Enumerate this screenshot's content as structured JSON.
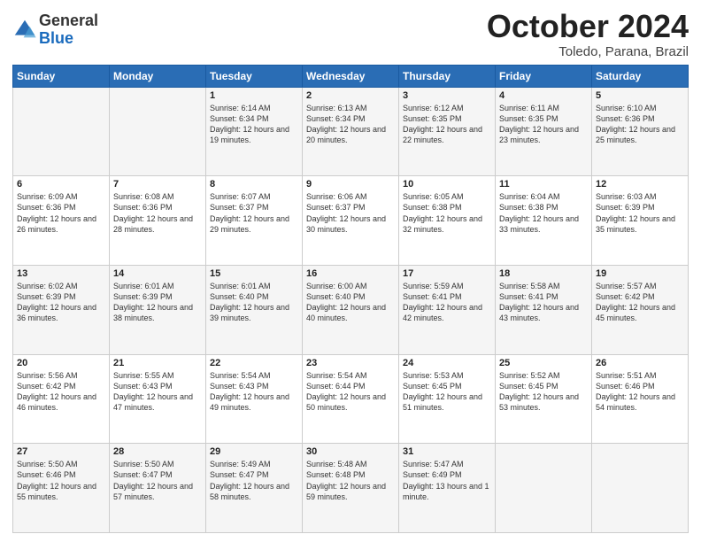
{
  "logo": {
    "general": "General",
    "blue": "Blue"
  },
  "header": {
    "month": "October 2024",
    "location": "Toledo, Parana, Brazil"
  },
  "weekdays": [
    "Sunday",
    "Monday",
    "Tuesday",
    "Wednesday",
    "Thursday",
    "Friday",
    "Saturday"
  ],
  "weeks": [
    [
      {
        "day": "",
        "sunrise": "",
        "sunset": "",
        "daylight": ""
      },
      {
        "day": "",
        "sunrise": "",
        "sunset": "",
        "daylight": ""
      },
      {
        "day": "1",
        "sunrise": "Sunrise: 6:14 AM",
        "sunset": "Sunset: 6:34 PM",
        "daylight": "Daylight: 12 hours and 19 minutes."
      },
      {
        "day": "2",
        "sunrise": "Sunrise: 6:13 AM",
        "sunset": "Sunset: 6:34 PM",
        "daylight": "Daylight: 12 hours and 20 minutes."
      },
      {
        "day": "3",
        "sunrise": "Sunrise: 6:12 AM",
        "sunset": "Sunset: 6:35 PM",
        "daylight": "Daylight: 12 hours and 22 minutes."
      },
      {
        "day": "4",
        "sunrise": "Sunrise: 6:11 AM",
        "sunset": "Sunset: 6:35 PM",
        "daylight": "Daylight: 12 hours and 23 minutes."
      },
      {
        "day": "5",
        "sunrise": "Sunrise: 6:10 AM",
        "sunset": "Sunset: 6:36 PM",
        "daylight": "Daylight: 12 hours and 25 minutes."
      }
    ],
    [
      {
        "day": "6",
        "sunrise": "Sunrise: 6:09 AM",
        "sunset": "Sunset: 6:36 PM",
        "daylight": "Daylight: 12 hours and 26 minutes."
      },
      {
        "day": "7",
        "sunrise": "Sunrise: 6:08 AM",
        "sunset": "Sunset: 6:36 PM",
        "daylight": "Daylight: 12 hours and 28 minutes."
      },
      {
        "day": "8",
        "sunrise": "Sunrise: 6:07 AM",
        "sunset": "Sunset: 6:37 PM",
        "daylight": "Daylight: 12 hours and 29 minutes."
      },
      {
        "day": "9",
        "sunrise": "Sunrise: 6:06 AM",
        "sunset": "Sunset: 6:37 PM",
        "daylight": "Daylight: 12 hours and 30 minutes."
      },
      {
        "day": "10",
        "sunrise": "Sunrise: 6:05 AM",
        "sunset": "Sunset: 6:38 PM",
        "daylight": "Daylight: 12 hours and 32 minutes."
      },
      {
        "day": "11",
        "sunrise": "Sunrise: 6:04 AM",
        "sunset": "Sunset: 6:38 PM",
        "daylight": "Daylight: 12 hours and 33 minutes."
      },
      {
        "day": "12",
        "sunrise": "Sunrise: 6:03 AM",
        "sunset": "Sunset: 6:39 PM",
        "daylight": "Daylight: 12 hours and 35 minutes."
      }
    ],
    [
      {
        "day": "13",
        "sunrise": "Sunrise: 6:02 AM",
        "sunset": "Sunset: 6:39 PM",
        "daylight": "Daylight: 12 hours and 36 minutes."
      },
      {
        "day": "14",
        "sunrise": "Sunrise: 6:01 AM",
        "sunset": "Sunset: 6:39 PM",
        "daylight": "Daylight: 12 hours and 38 minutes."
      },
      {
        "day": "15",
        "sunrise": "Sunrise: 6:01 AM",
        "sunset": "Sunset: 6:40 PM",
        "daylight": "Daylight: 12 hours and 39 minutes."
      },
      {
        "day": "16",
        "sunrise": "Sunrise: 6:00 AM",
        "sunset": "Sunset: 6:40 PM",
        "daylight": "Daylight: 12 hours and 40 minutes."
      },
      {
        "day": "17",
        "sunrise": "Sunrise: 5:59 AM",
        "sunset": "Sunset: 6:41 PM",
        "daylight": "Daylight: 12 hours and 42 minutes."
      },
      {
        "day": "18",
        "sunrise": "Sunrise: 5:58 AM",
        "sunset": "Sunset: 6:41 PM",
        "daylight": "Daylight: 12 hours and 43 minutes."
      },
      {
        "day": "19",
        "sunrise": "Sunrise: 5:57 AM",
        "sunset": "Sunset: 6:42 PM",
        "daylight": "Daylight: 12 hours and 45 minutes."
      }
    ],
    [
      {
        "day": "20",
        "sunrise": "Sunrise: 5:56 AM",
        "sunset": "Sunset: 6:42 PM",
        "daylight": "Daylight: 12 hours and 46 minutes."
      },
      {
        "day": "21",
        "sunrise": "Sunrise: 5:55 AM",
        "sunset": "Sunset: 6:43 PM",
        "daylight": "Daylight: 12 hours and 47 minutes."
      },
      {
        "day": "22",
        "sunrise": "Sunrise: 5:54 AM",
        "sunset": "Sunset: 6:43 PM",
        "daylight": "Daylight: 12 hours and 49 minutes."
      },
      {
        "day": "23",
        "sunrise": "Sunrise: 5:54 AM",
        "sunset": "Sunset: 6:44 PM",
        "daylight": "Daylight: 12 hours and 50 minutes."
      },
      {
        "day": "24",
        "sunrise": "Sunrise: 5:53 AM",
        "sunset": "Sunset: 6:45 PM",
        "daylight": "Daylight: 12 hours and 51 minutes."
      },
      {
        "day": "25",
        "sunrise": "Sunrise: 5:52 AM",
        "sunset": "Sunset: 6:45 PM",
        "daylight": "Daylight: 12 hours and 53 minutes."
      },
      {
        "day": "26",
        "sunrise": "Sunrise: 5:51 AM",
        "sunset": "Sunset: 6:46 PM",
        "daylight": "Daylight: 12 hours and 54 minutes."
      }
    ],
    [
      {
        "day": "27",
        "sunrise": "Sunrise: 5:50 AM",
        "sunset": "Sunset: 6:46 PM",
        "daylight": "Daylight: 12 hours and 55 minutes."
      },
      {
        "day": "28",
        "sunrise": "Sunrise: 5:50 AM",
        "sunset": "Sunset: 6:47 PM",
        "daylight": "Daylight: 12 hours and 57 minutes."
      },
      {
        "day": "29",
        "sunrise": "Sunrise: 5:49 AM",
        "sunset": "Sunset: 6:47 PM",
        "daylight": "Daylight: 12 hours and 58 minutes."
      },
      {
        "day": "30",
        "sunrise": "Sunrise: 5:48 AM",
        "sunset": "Sunset: 6:48 PM",
        "daylight": "Daylight: 12 hours and 59 minutes."
      },
      {
        "day": "31",
        "sunrise": "Sunrise: 5:47 AM",
        "sunset": "Sunset: 6:49 PM",
        "daylight": "Daylight: 13 hours and 1 minute."
      },
      {
        "day": "",
        "sunrise": "",
        "sunset": "",
        "daylight": ""
      },
      {
        "day": "",
        "sunrise": "",
        "sunset": "",
        "daylight": ""
      }
    ]
  ]
}
